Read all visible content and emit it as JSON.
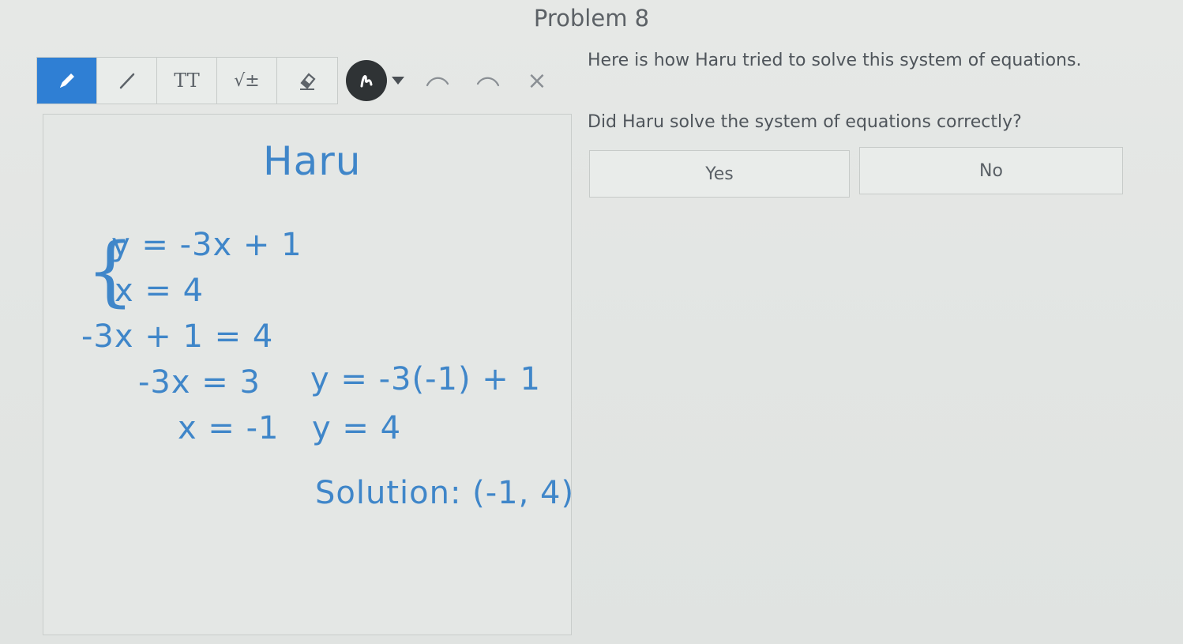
{
  "problem": {
    "title": "Problem 8"
  },
  "toolbar": {
    "tools": [
      {
        "name": "pen",
        "icon": "pencil-icon",
        "active": true
      },
      {
        "name": "line",
        "icon": "line-icon",
        "active": false
      },
      {
        "name": "text",
        "icon": "text-size-icon",
        "label": "TT",
        "active": false
      },
      {
        "name": "math",
        "icon": "square-root-icon",
        "label": "√±",
        "active": false
      },
      {
        "name": "eraser",
        "icon": "eraser-icon",
        "active": false
      }
    ],
    "pen_color": "#2f3335",
    "close_label": "×"
  },
  "work": {
    "student_name": "Haru",
    "system_line1": "y = -3x + 1",
    "system_line2": "x = 4",
    "step1": "-3x + 1 = 4",
    "step2": "-3x = 3",
    "step3": "x = -1",
    "step4": "y = -3(-1) + 1",
    "step5": "y = 4",
    "solution": "Solution: (-1, 4)"
  },
  "question": {
    "prompt": "Here is how Haru tried to solve this system of equations.",
    "text": "Did Haru solve the system of equations correctly?",
    "options": [
      "Yes",
      "No"
    ]
  },
  "colors": {
    "accent": "#2f7fd4",
    "handwriting": "#3f86c9"
  }
}
